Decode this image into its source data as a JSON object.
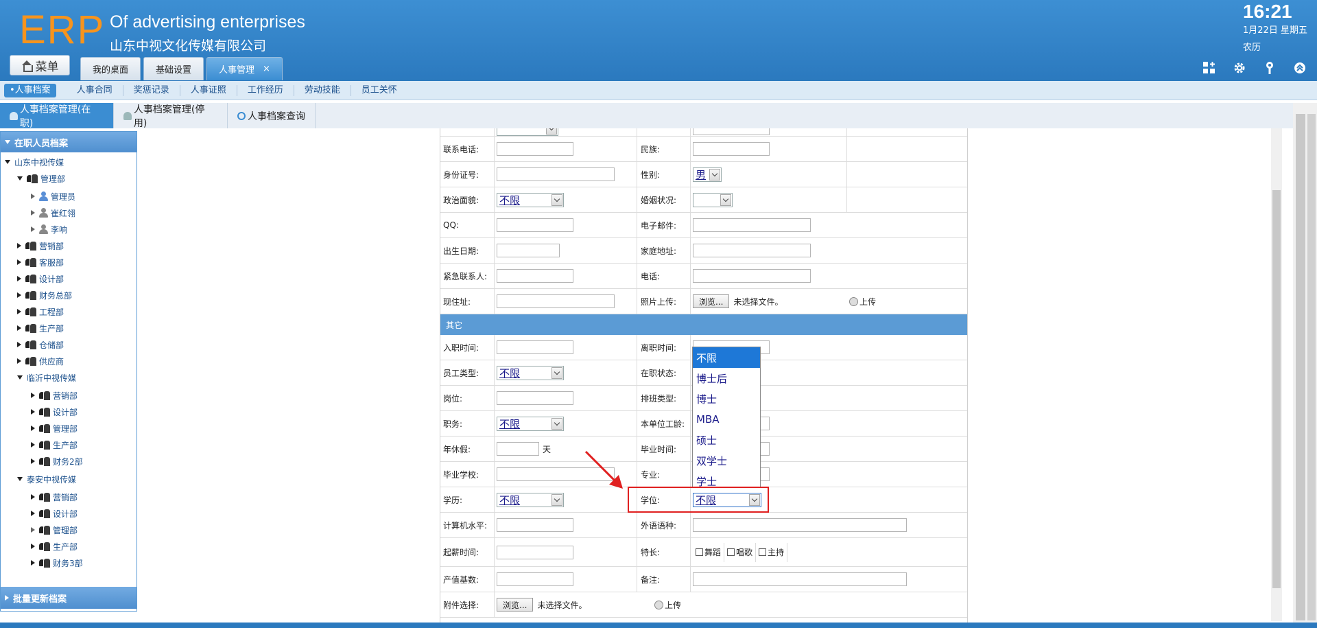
{
  "header": {
    "logo": "ERP",
    "subtitle_en": "Of advertising enterprises",
    "subtitle_cn": "山东中视文化传媒有限公司",
    "time": "16:21",
    "date": "1月22日 星期五",
    "lunar": "农历",
    "menu_label": "菜单",
    "tabs": [
      {
        "label": "我的桌面"
      },
      {
        "label": "基础设置"
      },
      {
        "label": "人事管理",
        "close": "×"
      }
    ]
  },
  "subnav": {
    "items": [
      "•人事档案",
      "人事合同",
      "奖惩记录",
      "人事证照",
      "工作经历",
      "劳动技能",
      "员工关怀"
    ]
  },
  "tabs2": {
    "items": [
      "人事档案管理(在职)",
      "人事档案管理(停用)",
      "人事档案查询"
    ]
  },
  "sidebar": {
    "header": "在职人员档案",
    "footer": "批量更新档案",
    "tree": [
      {
        "label": "山东中视传媒"
      },
      {
        "label": "管理部"
      },
      {
        "label": "管理员"
      },
      {
        "label": "崔红翎"
      },
      {
        "label": "李响"
      },
      {
        "label": "营销部"
      },
      {
        "label": "客服部"
      },
      {
        "label": "设计部"
      },
      {
        "label": "财务总部"
      },
      {
        "label": "工程部"
      },
      {
        "label": "生产部"
      },
      {
        "label": "仓储部"
      },
      {
        "label": "供应商"
      },
      {
        "label": "临沂中视传媒"
      },
      {
        "label": "营销部"
      },
      {
        "label": "设计部"
      },
      {
        "label": "管理部"
      },
      {
        "label": "生产部"
      },
      {
        "label": "财务2部"
      },
      {
        "label": "泰安中视传媒"
      },
      {
        "label": "营销部"
      },
      {
        "label": "设计部"
      },
      {
        "label": "管理部"
      },
      {
        "label": "生产部"
      },
      {
        "label": "财务3部"
      }
    ]
  },
  "form": {
    "phone": "联系电话:",
    "ethnic": "民族:",
    "idcard": "身份证号:",
    "gender": "性别:",
    "gender_value": "男",
    "politics": "政治面貌:",
    "politics_value": "不限",
    "marital": "婚姻状况:",
    "qq": "QQ:",
    "email": "电子邮件:",
    "birth": "出生日期:",
    "home_addr": "家庭地址:",
    "emergency": "紧急联系人:",
    "tel": "电话:",
    "cur_addr": "现住址:",
    "photo": "照片上传:",
    "browse": "浏览...",
    "no_file": "未选择文件。",
    "upload": "上传",
    "section_other": "其它",
    "entry_date": "入职时间:",
    "leave_date": "离职时间:",
    "emp_type": "员工类型:",
    "emp_type_value": "不限",
    "job_status": "在职状态:",
    "post": "岗位:",
    "shift_type": "排班类型:",
    "duty": "职务:",
    "duty_value": "不限",
    "seniority": "本单位工龄:",
    "annual_leave": "年休假:",
    "day_unit": "天",
    "grad_date": "毕业时间:",
    "grad_school": "毕业学校:",
    "major": "专业:",
    "education": "学历:",
    "education_value": "不限",
    "degree": "学位:",
    "degree_value": "不限",
    "computer": "计算机水平:",
    "language": "外语语种:",
    "salary_start": "起薪时间:",
    "specialty": "特长:",
    "spec_options": [
      "舞蹈",
      "唱歌",
      "主持"
    ],
    "output_base": "产值基数:",
    "remark": "备注:",
    "attachment": "附件选择:"
  },
  "degree_dropdown": {
    "options": [
      "不限",
      "博士后",
      "博士",
      "MBA",
      "硕士",
      "双学士",
      "学士"
    ]
  }
}
